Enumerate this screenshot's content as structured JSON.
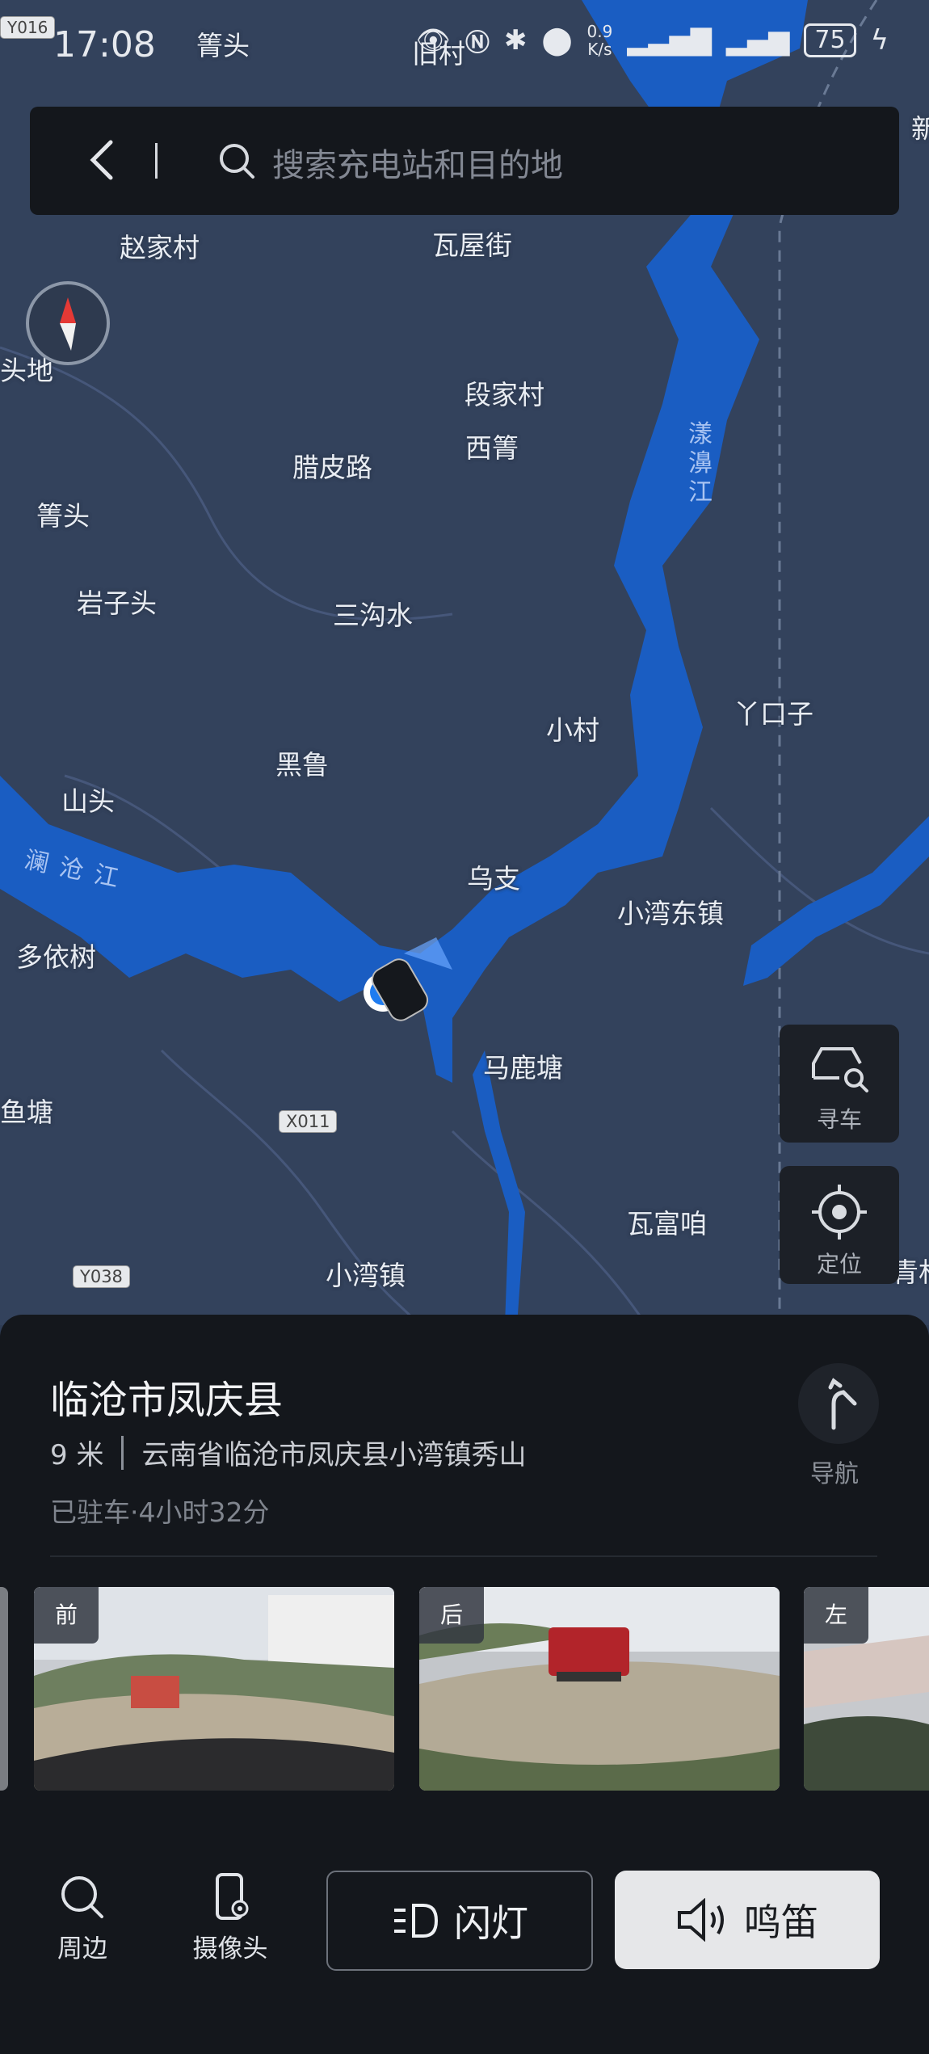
{
  "status_bar": {
    "time": "17:08",
    "net_speed_value": "0.9",
    "net_speed_unit": "K/s",
    "battery": "75",
    "corner_badge": "Y016"
  },
  "search": {
    "placeholder": "搜索充电站和目的地"
  },
  "map": {
    "places": {
      "p1": "箐头",
      "p2": "旧村",
      "p3": "赵家村",
      "p4": "瓦屋街",
      "p5": "头地",
      "p6": "段家村",
      "p7": "西箐",
      "p8": "腊皮路",
      "p9": "箐头",
      "p10": "岩子头",
      "p11": "三沟水",
      "p12": "小村",
      "p13": "丫口子",
      "p14": "黑鲁",
      "p15": "山头",
      "p16": "乌支",
      "p17": "小湾东镇",
      "p18": "多依树",
      "p19": "马鹿塘",
      "p20": "鱼塘",
      "p21": "瓦富咱",
      "p22": "小湾镇",
      "p23": "青杉",
      "p24": "新"
    },
    "rivers": {
      "r1": "漾濞江",
      "r2": "澜沧江"
    },
    "roads": {
      "road1": "X011",
      "road2": "Y038"
    },
    "colors": {
      "land": "#33425c",
      "water": "#1a5dc2"
    }
  },
  "side_buttons": {
    "find_car": "寻车",
    "locate": "定位"
  },
  "panel": {
    "title": "临沧市凤庆县",
    "distance": "9 米",
    "address": "云南省临沧市凤庆县小湾镇秀山",
    "parked": "已驻车·4小时32分",
    "navigate": "导航",
    "cameras": {
      "front": "前",
      "rear": "后",
      "left": "左"
    }
  },
  "bottom_bar": {
    "nearby": "周边",
    "camera": "摄像头",
    "flash": "闪灯",
    "horn": "鸣笛"
  }
}
